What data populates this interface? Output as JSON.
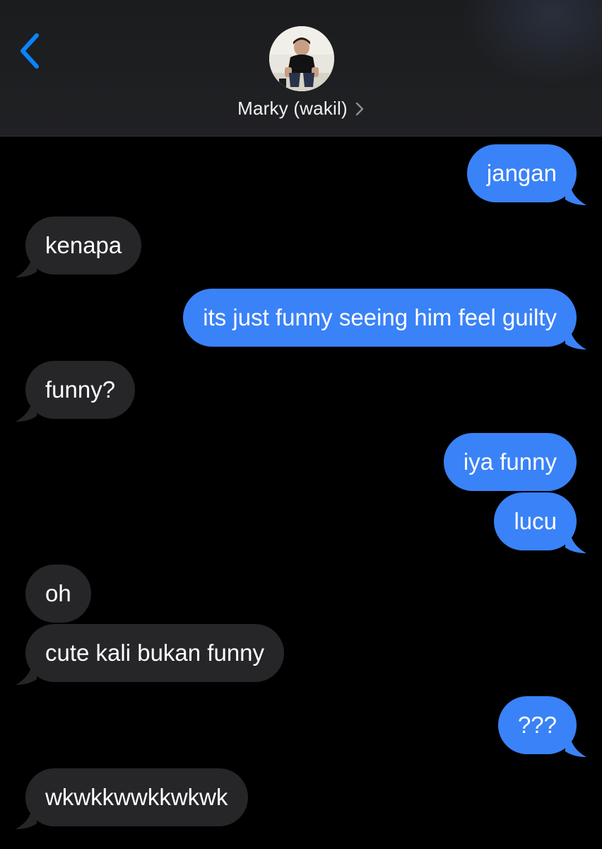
{
  "contact": {
    "name": "Marky (wakil)",
    "avatar_icon": "profile-photo"
  },
  "colors": {
    "sent_bubble": "#3a82f7",
    "received_bubble": "#262629",
    "accent_blue": "#0a84ff",
    "background": "#000000"
  },
  "messages": [
    {
      "direction": "sent",
      "text": "jangan"
    },
    {
      "direction": "received",
      "text": "kenapa"
    },
    {
      "direction": "sent",
      "text": "its just funny seeing him feel guilty"
    },
    {
      "direction": "received",
      "text": "funny?"
    },
    {
      "direction": "sent",
      "text": "iya funny"
    },
    {
      "direction": "sent",
      "text": "lucu"
    },
    {
      "direction": "received",
      "text": "oh"
    },
    {
      "direction": "received",
      "text": "cute kali bukan funny"
    },
    {
      "direction": "sent",
      "text": "???"
    },
    {
      "direction": "received",
      "text": "wkwkkwwkkwkwk"
    }
  ]
}
